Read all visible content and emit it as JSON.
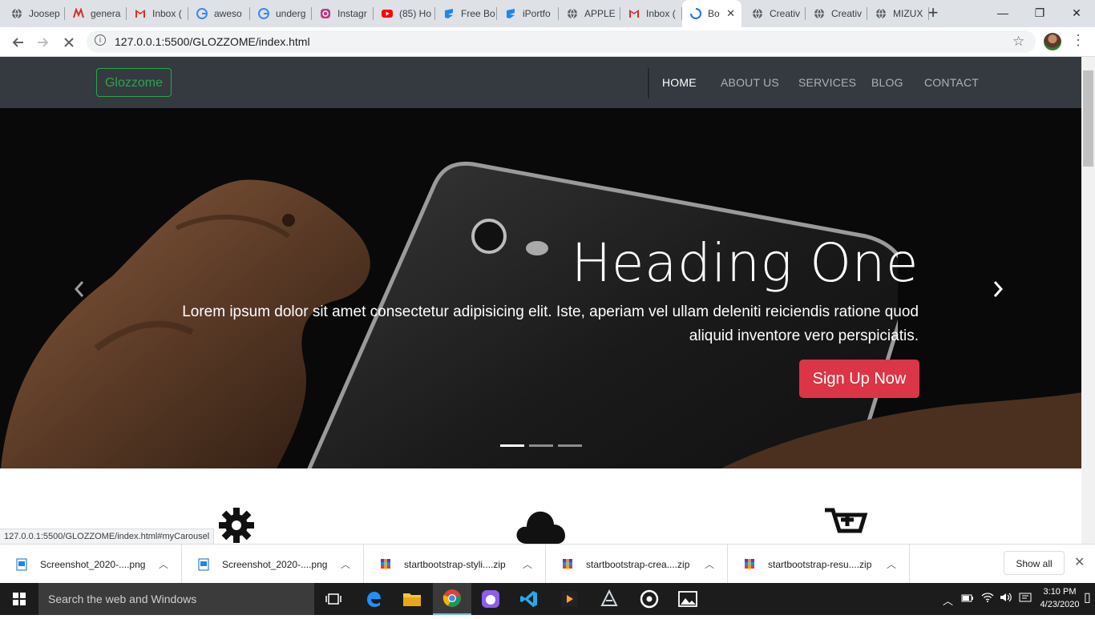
{
  "browser": {
    "tabs": [
      {
        "title": "Joosep",
        "icon": "globe-icon"
      },
      {
        "title": "genera",
        "icon": "logo-icon"
      },
      {
        "title": "Inbox (",
        "icon": "gmail-icon"
      },
      {
        "title": "aweso",
        "icon": "google-icon"
      },
      {
        "title": "underg",
        "icon": "google-icon"
      },
      {
        "title": "Instagr",
        "icon": "instagram-icon"
      },
      {
        "title": "(85) Ho",
        "icon": "youtube-icon"
      },
      {
        "title": "Free Bo",
        "icon": "bootstrap-icon"
      },
      {
        "title": "iPortfo",
        "icon": "bootstrap-icon"
      },
      {
        "title": "APPLE",
        "icon": "globe-icon"
      },
      {
        "title": "Inbox (",
        "icon": "gmail-icon"
      },
      {
        "title": "Bo",
        "icon": "loading-icon",
        "active": true
      },
      {
        "title": "Creativ",
        "icon": "globe-icon"
      },
      {
        "title": "Creativ",
        "icon": "globe-icon"
      },
      {
        "title": "MIZUX",
        "icon": "globe-icon"
      }
    ],
    "new_tab": "+",
    "window_controls": {
      "minimize": "—",
      "restore": "❐",
      "close": "✕"
    },
    "url": "127.0.0.1:5500/GLOZZOME/index.html",
    "status_url": "127.0.0.1:5500/GLOZZOME/index.html#myCarousel"
  },
  "site": {
    "brand": "Glozzome",
    "nav": [
      "HOME",
      "ABOUT US",
      "SERVICES",
      "BLOG",
      "CONTACT"
    ],
    "nav_active": "HOME",
    "hero": {
      "heading": "Heading One",
      "text_line1": "Lorem ipsum dolor sit amet consectetur adipisicing elit. Iste, aperiam vel ullam deleniti reiciendis ratione quod",
      "text_line2": "aliquid inventore vero perspiciatis.",
      "button": "Sign Up Now",
      "slides": 3,
      "active_slide": 1
    },
    "features": [
      "gear-icon",
      "cloud-icon",
      "cart-plus-icon"
    ],
    "colors": {
      "navbar": "#343a40",
      "brand": "#28a745",
      "button": "#dc3545"
    }
  },
  "downloads": {
    "items": [
      {
        "name": "Screenshot_2020-....png",
        "type": "png"
      },
      {
        "name": "Screenshot_2020-....png",
        "type": "png"
      },
      {
        "name": "startbootstrap-styli....zip",
        "type": "zip"
      },
      {
        "name": "startbootstrap-crea....zip",
        "type": "zip"
      },
      {
        "name": "startbootstrap-resu....zip",
        "type": "zip"
      }
    ],
    "show_all": "Show all"
  },
  "taskbar": {
    "search_placeholder": "Search the web and Windows",
    "time": "3:10 PM",
    "date": "4/23/2020"
  }
}
